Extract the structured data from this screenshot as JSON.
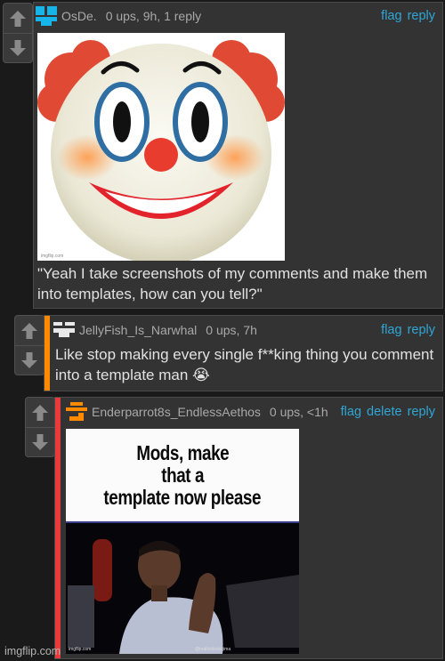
{
  "colors": {
    "background": "#1a1a1a",
    "comment_bg": "#333333",
    "link": "#2fa6d6",
    "avatar_blue": "#17b4e9",
    "avatar_white": "#e8e8e8",
    "avatar_orange": "#ff8a00",
    "stripe_orange": "#ff8a00",
    "stripe_red": "#e83a3a"
  },
  "comments": [
    {
      "username": "OsDe.",
      "meta": "0 ups, 9h, 1 reply",
      "avatar_icon": "blocky-avatar-blue",
      "actions": [
        "flag",
        "reply"
      ],
      "image": {
        "type": "clown-face-emoji",
        "watermark": "imgflip.com"
      },
      "text": "\"Yeah I take screenshots of my comments and make them into templates, how can you tell?\""
    },
    {
      "username": "JellyFish_Is_Narwhal",
      "meta": "0 ups, 7h",
      "avatar_icon": "blocky-avatar-white",
      "actions": [
        "flag",
        "reply"
      ],
      "text": "Like stop making every single f**king thing you comment into a template man",
      "emoji": "😭"
    },
    {
      "username": "Enderparrot8s_EndlessAethos",
      "meta": "0 ups, <1h",
      "avatar_icon": "blocky-avatar-orange",
      "actions": [
        "flag",
        "delete",
        "reply"
      ],
      "image": {
        "type": "meme-caption-photo",
        "caption_lines": [
          "Mods, make",
          "that a",
          "template now please"
        ],
        "watermark": "imgflip.com",
        "credit": "@realhideokojima"
      }
    }
  ],
  "vote": {
    "up_icon": "upvote-arrow-icon",
    "down_icon": "downvote-arrow-icon"
  },
  "footer_watermark": "imgflip.com"
}
